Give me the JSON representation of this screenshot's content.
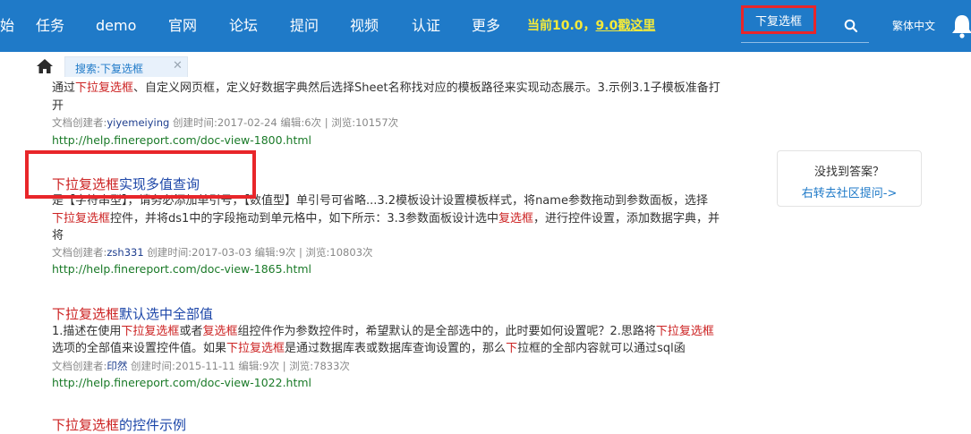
{
  "nav": {
    "items": [
      "任务",
      "demo",
      "官网",
      "论坛",
      "提问",
      "视频",
      "认证",
      "更多"
    ],
    "promo_text": "当前10.0，",
    "promo_link": "9.0戳这里",
    "search_value": "下复选框",
    "lang": "繁体中文",
    "icons": {
      "search": "search-icon",
      "bell": "bell-icon"
    }
  },
  "tabbar": {
    "tab_label": "搜索:下复选框",
    "close": "✕",
    "icons": {
      "home": "home-icon"
    }
  },
  "results": [
    {
      "snippet": [
        [
          [
            "通过",
            false
          ],
          [
            "下拉",
            true
          ],
          [
            "复选框",
            true
          ],
          [
            "、自定义网页框，定义好数据字典然后选择Sheet名称找对应的模板路径来实现动态展示。3.示例3.1子模板准备打",
            false
          ]
        ],
        [
          [
            "开",
            false
          ]
        ]
      ],
      "meta_prefix": "文档创建者:",
      "author": "yiyemeiying",
      "meta_rest": "  创建时间:2017-02-24 编辑:6次 | 浏览:10157次",
      "url": "http://help.finereport.com/doc-view-1800.html"
    },
    {
      "title": [
        [
          "下拉",
          true
        ],
        [
          "复选框",
          true
        ],
        [
          "实现多值查询",
          false
        ]
      ],
      "snippet": [
        [
          [
            "是【字符串型】，请务必添加单引号，【数值型】单引号可省略...3.2模板设计设置模板样式，将name参数拖动到参数面板，选择",
            false
          ]
        ],
        [
          [
            "下拉",
            true
          ],
          [
            "复选框",
            true
          ],
          [
            "控件，并将ds1中的字段拖动到单元格中，如下所示：3.3参数面板设计选中",
            false
          ],
          [
            "复选框",
            true
          ],
          [
            "，进行控件设置，添加数据字典，并",
            false
          ]
        ],
        [
          [
            "将",
            false
          ]
        ]
      ],
      "meta_prefix": "文档创建者:",
      "author": "zsh331",
      "meta_rest": "  创建时间:2017-03-03 编辑:9次 | 浏览:10803次",
      "url": "http://help.finereport.com/doc-view-1865.html"
    },
    {
      "title": [
        [
          "下拉",
          true
        ],
        [
          "复选框",
          true
        ],
        [
          "默认选中全部值",
          false
        ]
      ],
      "snippet": [
        [
          [
            "1.描述在使用",
            false
          ],
          [
            "下拉",
            true
          ],
          [
            "复选框",
            true
          ],
          [
            "或者",
            false
          ],
          [
            "复选框",
            true
          ],
          [
            "组控件作为参数控件时，希望默认的是全部选中的，此时要如何设置呢？2.思路将",
            false
          ],
          [
            "下拉",
            true
          ],
          [
            "复选框",
            true
          ]
        ],
        [
          [
            "选项的全部值来设置控件值。如果",
            false
          ],
          [
            "下拉",
            true
          ],
          [
            "复选框",
            true
          ],
          [
            "是通过数据库表或数据库查询设置的，那么",
            false
          ],
          [
            "下",
            true
          ],
          [
            "拉框的全部内容就可以通过sql函",
            false
          ]
        ]
      ],
      "meta_prefix": "文档创建者:",
      "author": "印然",
      "meta_rest": "  创建时间:2015-11-11 编辑:9次 | 浏览:7833次",
      "url": "http://help.finereport.com/doc-view-1022.html"
    },
    {
      "title": [
        [
          "下拉",
          true
        ],
        [
          "复选框",
          true
        ],
        [
          "的控件示例",
          false
        ]
      ]
    }
  ],
  "side": {
    "question": "没找到答案？",
    "link": "右转去社区提问->"
  }
}
